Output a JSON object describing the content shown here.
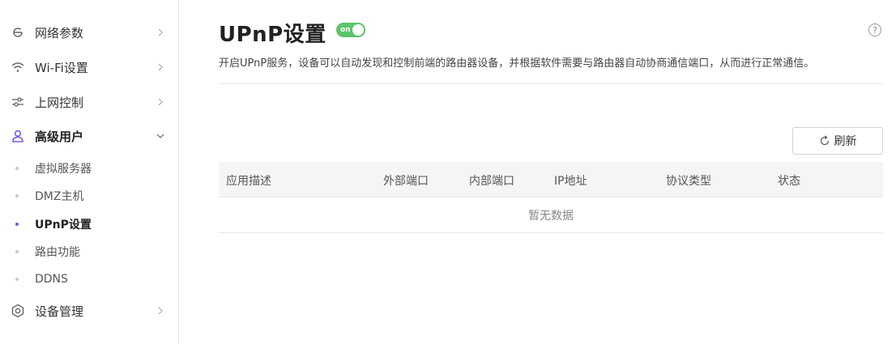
{
  "sidebar": {
    "items": [
      {
        "label": "网络参数",
        "icon": "network-icon"
      },
      {
        "label": "Wi-Fi设置",
        "icon": "wifi-icon"
      },
      {
        "label": "上网控制",
        "icon": "sliders-icon"
      },
      {
        "label": "高级用户",
        "icon": "user-icon"
      },
      {
        "label": "设备管理",
        "icon": "gear-icon"
      }
    ],
    "subitems": [
      {
        "label": "虚拟服务器"
      },
      {
        "label": "DMZ主机"
      },
      {
        "label": "UPnP设置"
      },
      {
        "label": "路由功能"
      },
      {
        "label": "DDNS"
      }
    ]
  },
  "page": {
    "title": "UPnP设置",
    "toggle_label": "on",
    "help_label": "?",
    "description": "开启UPnP服务，设备可以自动发现和控制前端的路由器设备，并根据软件需要与路由器自动协商通信端口，从而进行正常通信。",
    "refresh_label": "刷新"
  },
  "table": {
    "columns": [
      "应用描述",
      "外部端口",
      "内部端口",
      "IP地址",
      "协议类型",
      "状态"
    ],
    "empty_text": "暂无数据"
  },
  "colors": {
    "accent": "#7b5cd6",
    "toggle_on": "#5cc46a"
  }
}
